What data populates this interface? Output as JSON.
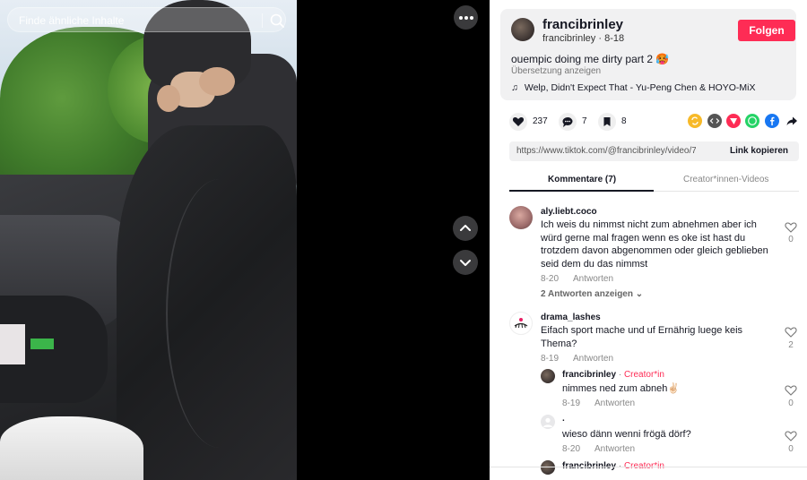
{
  "search": {
    "placeholder": "Finde ähnliche Inhalte"
  },
  "author": {
    "name": "francibrinley",
    "handle": "francibrinley",
    "date": "8-18",
    "follow_label": "Folgen"
  },
  "post": {
    "caption": "ouempic doing me dirty part 2 🥵",
    "translate_label": "Übersetzung anzeigen",
    "music": "Welp, Didn't Expect That - Yu-Peng Chen & HOYO-MiX"
  },
  "actions": {
    "likes": "237",
    "comments": "7",
    "saves": "8"
  },
  "share_colors": {
    "repost": "#f7b928",
    "embed": "#555555",
    "send": "#fe2c55",
    "whatsapp": "#25d366",
    "facebook": "#1877f2"
  },
  "link": {
    "url": "https://www.tiktok.com/@francibrinley/video/7539...",
    "copy_label": "Link kopieren"
  },
  "tabs": {
    "comments": "Kommentare (7)",
    "creator_videos": "Creator*innen-Videos"
  },
  "comments": [
    {
      "user": "aly.liebt.coco",
      "text_lines": [
        "Ich weis du nimmst nicht zum abnehmen aber ich",
        "würd gerne mal fragen wenn es oke ist hast du",
        "trotzdem davon abgenommen oder gleich geblieben",
        "seid dem du das nimmst"
      ],
      "date": "8-20",
      "reply_label": "Antworten",
      "likes": "0",
      "view_replies": "2 Antworten anzeigen"
    },
    {
      "user": "drama_lashes",
      "text_lines": [
        "Eifach sport mache und uf Ernährig luege keis",
        "Thema?"
      ],
      "date": "8-19",
      "reply_label": "Antworten",
      "likes": "2"
    }
  ],
  "replies": [
    {
      "user": "francibrinley",
      "sep": "·",
      "tag": "Creator*in",
      "text": "nimmes ned zum abneh✌🏻",
      "date": "8-19",
      "reply_label": "Antworten",
      "likes": "0"
    },
    {
      "user": ".",
      "text": "wieso dänn wenni frögä dörf?",
      "date": "8-20",
      "reply_label": "Antworten",
      "likes": "0"
    },
    {
      "user": "francibrinley",
      "sep": "·",
      "tag": "Creator*in"
    }
  ]
}
